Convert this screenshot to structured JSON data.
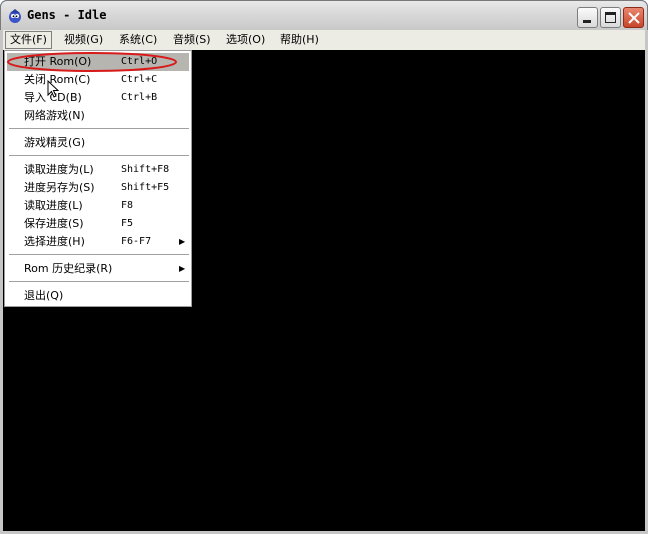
{
  "window": {
    "title": "Gens - Idle"
  },
  "menubar": {
    "items": [
      {
        "label": "文件(F)"
      },
      {
        "label": "视频(G)"
      },
      {
        "label": "系统(C)"
      },
      {
        "label": "音频(S)"
      },
      {
        "label": "选项(O)"
      },
      {
        "label": "帮助(H)"
      }
    ]
  },
  "file_menu": {
    "items": [
      {
        "label": "打开 Rom(O)",
        "shortcut": "Ctrl+O"
      },
      {
        "label": "关闭 Rom(C)",
        "shortcut": "Ctrl+C"
      },
      {
        "label": "导入 CD(B)",
        "shortcut": "Ctrl+B"
      },
      {
        "label": "网络游戏(N)",
        "shortcut": ""
      },
      {
        "label": "游戏精灵(G)",
        "shortcut": ""
      },
      {
        "label": "读取进度为(L)",
        "shortcut": "Shift+F8"
      },
      {
        "label": "进度另存为(S)",
        "shortcut": "Shift+F5"
      },
      {
        "label": "读取进度(L)",
        "shortcut": "F8"
      },
      {
        "label": "保存进度(S)",
        "shortcut": "F5"
      },
      {
        "label": "选择进度(H)",
        "shortcut": "F6-F7"
      },
      {
        "label": "Rom 历史纪录(R)",
        "shortcut": ""
      },
      {
        "label": "退出(Q)",
        "shortcut": ""
      }
    ]
  },
  "colors": {
    "screen": "#000000",
    "menu_highlight": "#b7b5b0",
    "annotation": "#d81a1a"
  }
}
